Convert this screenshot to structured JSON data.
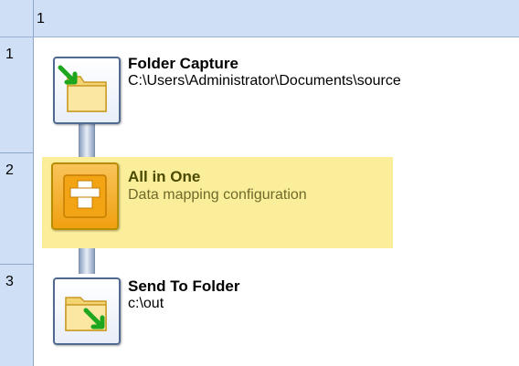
{
  "grid": {
    "column_header": "1",
    "row_headers": [
      "1",
      "2",
      "3"
    ]
  },
  "steps": [
    {
      "title": "Folder Capture",
      "subtitle": "C:\\Users\\Administrator\\Documents\\source",
      "icon": "folder-capture-icon",
      "selected": false
    },
    {
      "title": "All in One",
      "subtitle": "Data mapping configuration",
      "icon": "data-mapping-icon",
      "selected": true
    },
    {
      "title": "Send To Folder",
      "subtitle": "c:\\out",
      "icon": "send-to-folder-icon",
      "selected": false
    }
  ],
  "colors": {
    "header_background": "#cfdff6",
    "selection_highlight": "#fbee9a",
    "data_mapping_accent": "#f2a415",
    "arrow_green": "#1fa61f"
  }
}
